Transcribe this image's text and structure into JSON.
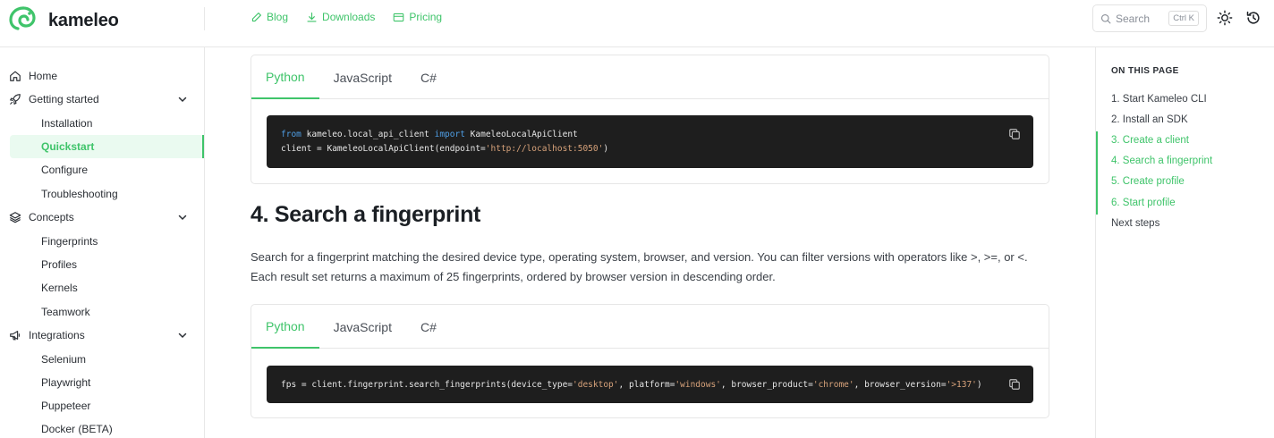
{
  "brand": {
    "name": "kameleo"
  },
  "topnav": [
    {
      "label": "Blog",
      "icon": "pencil-icon"
    },
    {
      "label": "Downloads",
      "icon": "download-icon"
    },
    {
      "label": "Pricing",
      "icon": "card-icon"
    }
  ],
  "search": {
    "placeholder": "Search",
    "shortcut": "Ctrl K"
  },
  "sidebar": {
    "items": [
      {
        "label": "Home",
        "icon": "home-icon"
      },
      {
        "label": "Getting started",
        "icon": "rocket-icon"
      },
      {
        "label": "Installation"
      },
      {
        "label": "Quickstart"
      },
      {
        "label": "Configure"
      },
      {
        "label": "Troubleshooting"
      },
      {
        "label": "Concepts",
        "icon": "layers-icon"
      },
      {
        "label": "Fingerprints"
      },
      {
        "label": "Profiles"
      },
      {
        "label": "Kernels"
      },
      {
        "label": "Teamwork"
      },
      {
        "label": "Integrations",
        "icon": "megaphone-icon"
      },
      {
        "label": "Selenium"
      },
      {
        "label": "Playwright"
      },
      {
        "label": "Puppeteer"
      },
      {
        "label": "Docker (BETA)"
      }
    ]
  },
  "code1": {
    "tabs": [
      "Python",
      "JavaScript",
      "C#"
    ],
    "line1_from": "from",
    "line1_mod": " kameleo.local_api_client ",
    "line1_import": "import",
    "line1_cls": " KameleoLocalApiClient",
    "line2_a": "client = KameleoLocalApiClient(endpoint=",
    "line2_str": "'http://localhost:5050'",
    "line2_b": ")"
  },
  "section": {
    "heading": "4. Search a fingerprint",
    "paragraph": "Search for a fingerprint matching the desired device type, operating system, browser, and version. You can filter versions with operators like >, >=, or <. Each result set returns a maximum of 25 fingerprints, ordered by browser version in descending order."
  },
  "code2": {
    "tabs": [
      "Python",
      "JavaScript",
      "C#"
    ],
    "p1": "fps = client.fingerprint.search_fingerprints(device_type=",
    "s1": "'desktop'",
    "p2": ", platform=",
    "s2": "'windows'",
    "p3": ", browser_product=",
    "s3": "'chrome'",
    "p4": ", browser_version=",
    "s4": "'>137'",
    "p5": ")"
  },
  "toc": {
    "title": "ON THIS PAGE",
    "items": [
      "1. Start Kameleo CLI",
      "2. Install an SDK",
      "3. Create a client",
      "4. Search a fingerprint",
      "5. Create profile",
      "6. Start profile",
      "Next steps"
    ]
  },
  "colors": {
    "accent": "#3fc46a",
    "code_bg": "#1e1e1e",
    "string": "#d7a27a",
    "keyword": "#4f9fe6"
  }
}
